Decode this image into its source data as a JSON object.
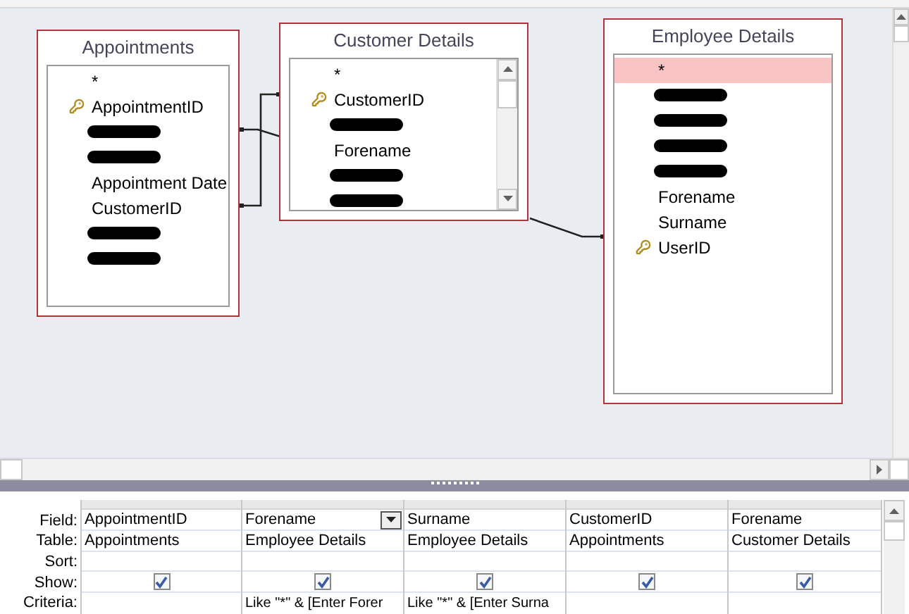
{
  "tables": [
    {
      "title": "Appointments",
      "fields": [
        {
          "kind": "field",
          "name": "*",
          "key": false,
          "selected": false
        },
        {
          "kind": "field",
          "name": "AppointmentID",
          "key": true,
          "selected": false
        },
        {
          "kind": "redacted"
        },
        {
          "kind": "redacted"
        },
        {
          "kind": "field",
          "name": "Appointment Date",
          "key": false,
          "selected": false
        },
        {
          "kind": "field",
          "name": "CustomerID",
          "key": false,
          "selected": false
        },
        {
          "kind": "redacted"
        },
        {
          "kind": "redacted"
        }
      ]
    },
    {
      "title": "Customer Details",
      "fields": [
        {
          "kind": "field",
          "name": "*",
          "key": false,
          "selected": false
        },
        {
          "kind": "field",
          "name": "CustomerID",
          "key": true,
          "selected": false
        },
        {
          "kind": "redacted"
        },
        {
          "kind": "field",
          "name": "Forename",
          "key": false,
          "selected": false
        },
        {
          "kind": "redacted"
        },
        {
          "kind": "redacted"
        }
      ]
    },
    {
      "title": "Employee Details",
      "fields": [
        {
          "kind": "field",
          "name": "*",
          "key": false,
          "selected": true
        },
        {
          "kind": "redacted"
        },
        {
          "kind": "redacted"
        },
        {
          "kind": "redacted"
        },
        {
          "kind": "redacted"
        },
        {
          "kind": "field",
          "name": "Forename",
          "key": false,
          "selected": false
        },
        {
          "kind": "field",
          "name": "Surname",
          "key": false,
          "selected": false
        },
        {
          "kind": "field",
          "name": "UserID",
          "key": true,
          "selected": false
        }
      ]
    }
  ],
  "grid": {
    "row_labels": [
      "Field:",
      "Table:",
      "Sort:",
      "Show:",
      "Criteria:"
    ],
    "columns": [
      {
        "field": "AppointmentID",
        "table": "Appointments",
        "show": true,
        "selected": false
      },
      {
        "field": "Forename",
        "table": "Employee Details",
        "show": true,
        "criteria": "Like \"*\" & [Enter Forer",
        "selected": true
      },
      {
        "field": "Surname",
        "table": "Employee Details",
        "show": true,
        "criteria": "Like \"*\" & [Enter Surna",
        "selected": false
      },
      {
        "field": "CustomerID",
        "table": "Appointments",
        "show": true,
        "selected": false
      },
      {
        "field": "Forename",
        "table": "Customer Details",
        "show": true,
        "selected": false
      }
    ]
  }
}
